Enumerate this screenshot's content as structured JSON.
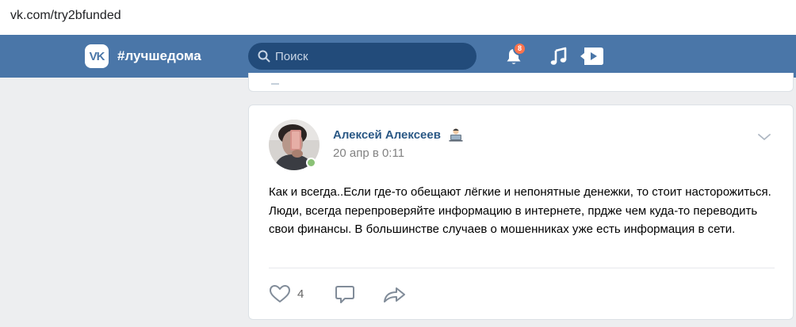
{
  "browser": {
    "url": "vk.com/try2bfunded"
  },
  "header": {
    "logo_text": "VK",
    "hashtag": "#лучшедома",
    "search_placeholder": "Поиск",
    "notifications_count": "8",
    "brand_color": "#4a76a8"
  },
  "post": {
    "author": "Алексей Алексеев",
    "author_badge_icon": "technologist-emoji-icon",
    "date": "20 апр в 0:11",
    "online": true,
    "text": "Как и всегда..Если где-то обещают лёгкие и непонятные денежки, то стоит насторожиться. Люди, всегда перепроверяйте информацию в интернете, прдже чем куда-то переводить свои финансы. В большинстве случаев о мошенниках уже есть информация в сети.",
    "likes": "4"
  }
}
